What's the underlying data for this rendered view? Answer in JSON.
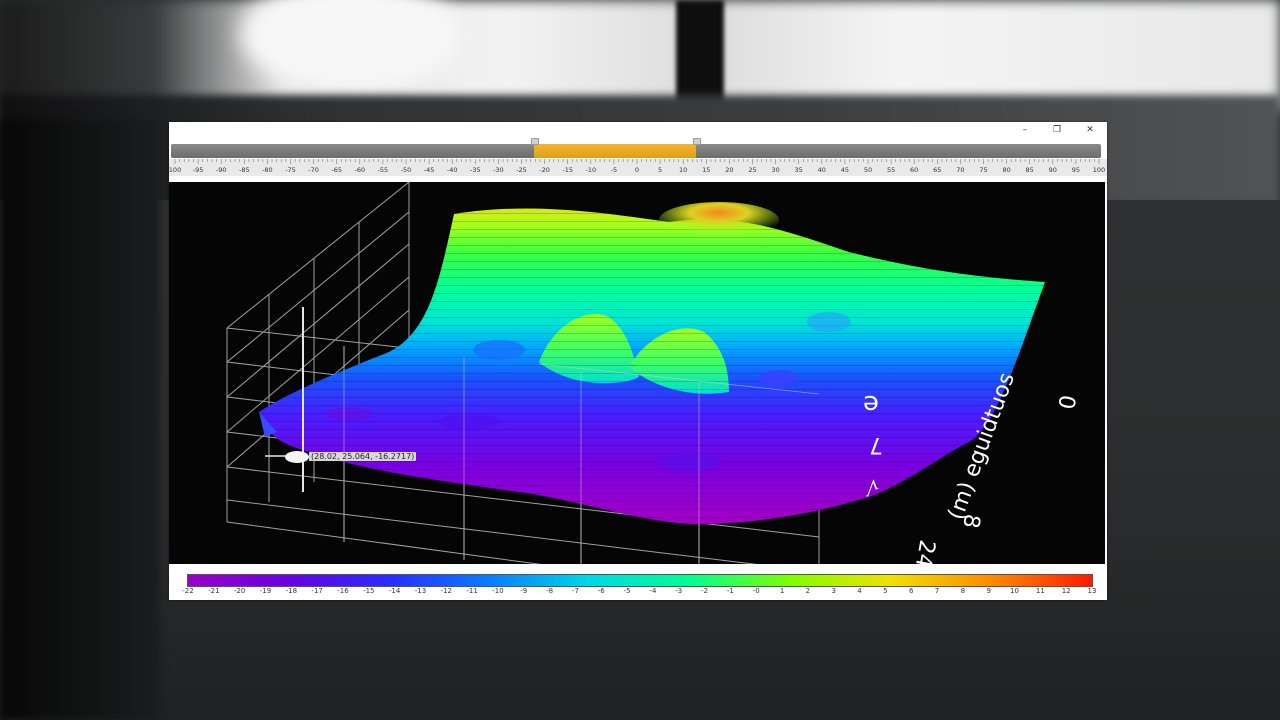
{
  "window": {
    "controls": {
      "minimize": "–",
      "maximize": "❐",
      "close": "✕"
    }
  },
  "range_slider": {
    "min": -100,
    "max": 100,
    "selected_start": -22,
    "selected_end": 13
  },
  "ruler_ticks": [
    "100",
    "-95",
    "-90",
    "-85",
    "-80",
    "-75",
    "-70",
    "-65",
    "-60",
    "-55",
    "-50",
    "-45",
    "-40",
    "-35",
    "-30",
    "-25",
    "-20",
    "-15",
    "-10",
    "-5",
    "0",
    "5",
    "10",
    "15",
    "20",
    "25",
    "30",
    "35",
    "40",
    "45",
    "50",
    "55",
    "60",
    "65",
    "70",
    "75",
    "80",
    "85",
    "90",
    "95",
    "100"
  ],
  "plot": {
    "cursor_readout": "(28.02, 25.064, -16.2717)",
    "axis_label_right": "(m) eguidtuos",
    "axis_numbers_right": [
      "0",
      "8",
      "24"
    ],
    "side_glyphs": [
      "e",
      "7",
      "√"
    ]
  },
  "colorbar": {
    "ticks": [
      "-22",
      "-21",
      "-20",
      "-19",
      "-18",
      "-17",
      "-16",
      "-15",
      "-14",
      "-13",
      "-12",
      "-11",
      "-10",
      "-9",
      "-8",
      "-7",
      "-6",
      "-5",
      "-4",
      "-3",
      "-2",
      "-1",
      "-0",
      "1",
      "2",
      "3",
      "4",
      "5",
      "6",
      "7",
      "8",
      "9",
      "10",
      "11",
      "12",
      "13"
    ],
    "colors": [
      "#9a00c8",
      "#6a00e0",
      "#2a2cff",
      "#0a7cff",
      "#00d8e8",
      "#00ff90",
      "#7fff00",
      "#f0e000",
      "#ff8a00",
      "#ff1a00"
    ]
  }
}
